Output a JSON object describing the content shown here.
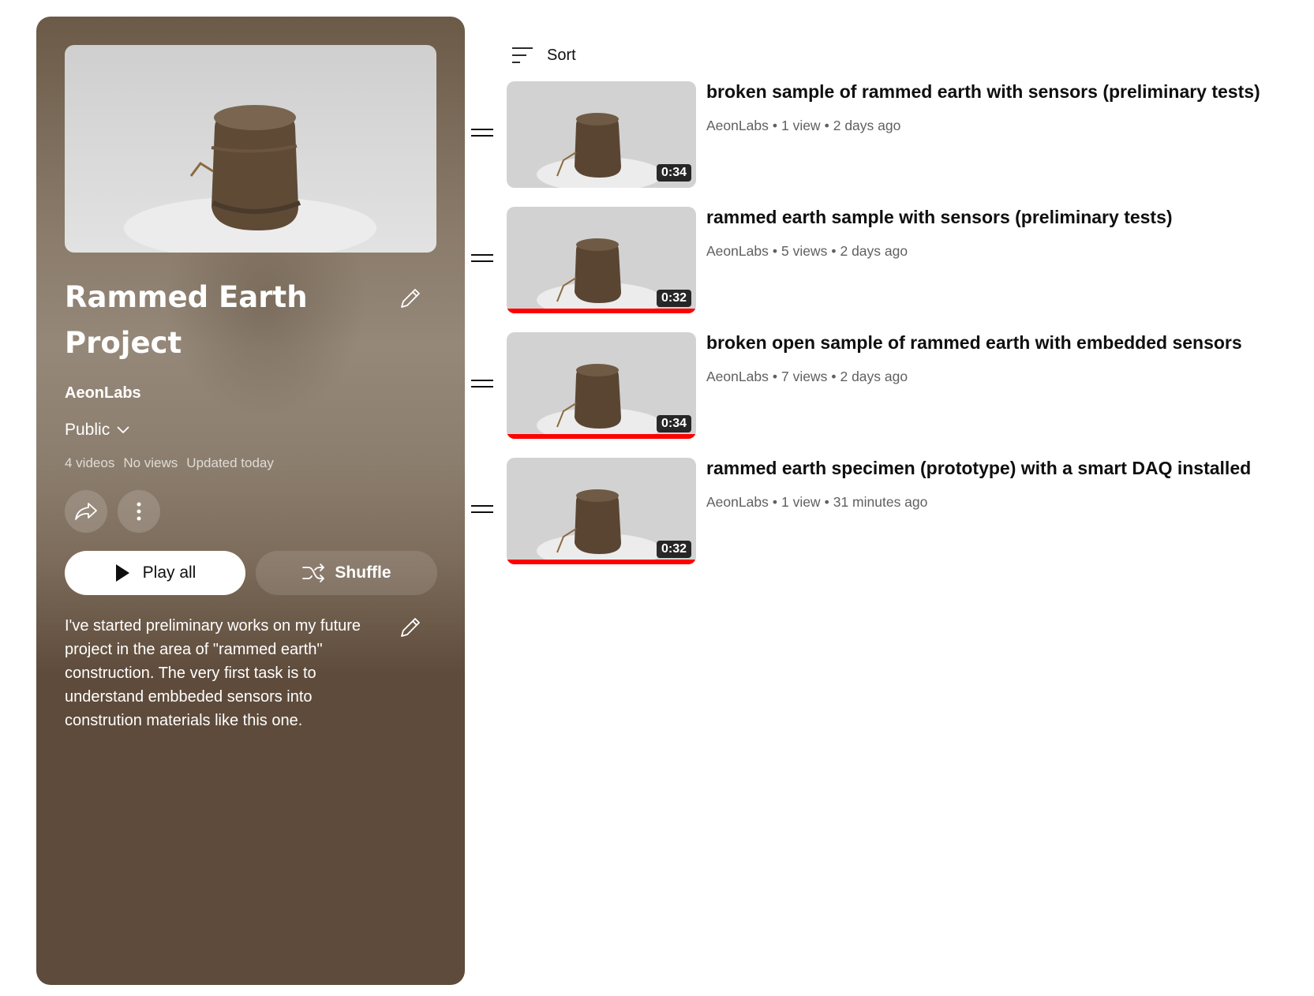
{
  "playlist": {
    "title": "Rammed Earth Project",
    "owner": "AeonLabs",
    "privacy": "Public",
    "stats": {
      "videos": "4 videos",
      "views": "No views",
      "updated": "Updated today"
    },
    "play_all_label": "Play all",
    "shuffle_label": "Shuffle",
    "description": "I've started preliminary works on my future project in the area of \"rammed earth\" construction. The very first task is to understand embbeded sensors into constrution materials like this one."
  },
  "list": {
    "sort_label": "Sort",
    "videos": [
      {
        "title": "broken sample of rammed earth with sensors (preliminary tests)",
        "channel": "AeonLabs",
        "views": "1 view",
        "age": "2 days ago",
        "duration": "0:34",
        "watched_fraction": 0
      },
      {
        "title": "rammed earth sample with sensors (preliminary tests)",
        "channel": "AeonLabs",
        "views": "5 views",
        "age": "2 days ago",
        "duration": "0:32",
        "watched_fraction": 1
      },
      {
        "title": "broken open sample of rammed earth with embedded sensors",
        "channel": "AeonLabs",
        "views": "7 views",
        "age": "2 days ago",
        "duration": "0:34",
        "watched_fraction": 1
      },
      {
        "title": "rammed earth specimen (prototype) with a smart DAQ installed",
        "channel": "AeonLabs",
        "views": "1 view",
        "age": "31 minutes ago",
        "duration": "0:32",
        "watched_fraction": 1
      }
    ]
  },
  "colors": {
    "panel_bg": "#5e4b3b",
    "progress": "#ff0000",
    "meta_text": "#606060"
  },
  "icons": [
    "edit-icon",
    "chevron-down-icon",
    "share-icon",
    "more-vert-icon",
    "play-icon",
    "shuffle-icon",
    "sort-icon",
    "drag-handle-icon"
  ]
}
